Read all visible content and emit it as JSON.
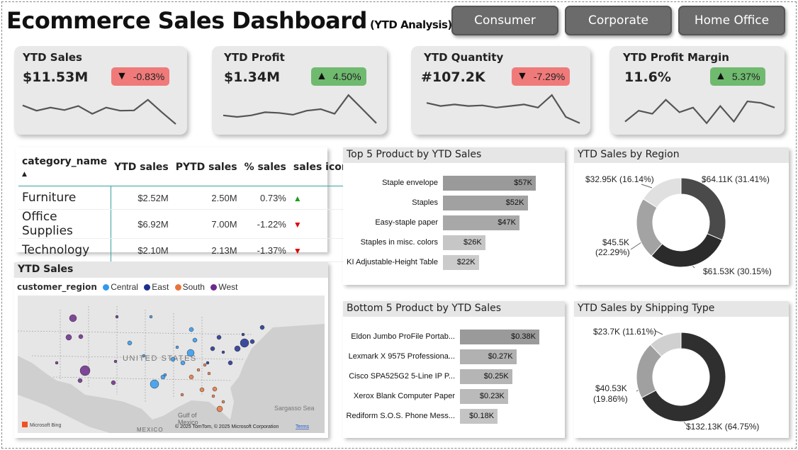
{
  "header": {
    "title": "Ecommerce Sales Dashboard",
    "subtitle": "(YTD Analysis)"
  },
  "segments": [
    "Consumer",
    "Corporate",
    "Home Office"
  ],
  "kpis": [
    {
      "title": "YTD Sales",
      "value": "$11.53M",
      "change": "-0.83%",
      "trend": "down",
      "spark": [
        0.62,
        0.45,
        0.55,
        0.47,
        0.6,
        0.35,
        0.55,
        0.45,
        0.46,
        0.8,
        0.4,
        0.02
      ]
    },
    {
      "title": "YTD Profit",
      "value": "$1.34M",
      "change": "4.50%",
      "trend": "up",
      "spark": [
        0.3,
        0.25,
        0.3,
        0.4,
        0.38,
        0.32,
        0.45,
        0.5,
        0.35,
        0.95,
        0.5,
        0.05
      ]
    },
    {
      "title": "YTD Quantity",
      "value": "#107.2K",
      "change": "-7.29%",
      "trend": "down",
      "spark": [
        0.7,
        0.6,
        0.65,
        0.6,
        0.62,
        0.55,
        0.6,
        0.65,
        0.55,
        0.95,
        0.25,
        0.05
      ]
    },
    {
      "title": "YTD Profit Margin",
      "value": "11.6%",
      "change": "5.37%",
      "trend": "up",
      "spark": [
        0.1,
        0.45,
        0.35,
        0.8,
        0.4,
        0.55,
        0.05,
        0.6,
        0.1,
        0.75,
        0.7,
        0.55
      ]
    }
  ],
  "category_table": {
    "headers": [
      "category_name",
      "YTD sales",
      "PYTD sales",
      "% sales",
      "sales icon"
    ],
    "rows": [
      {
        "name": "Furniture",
        "ytd": "$2.52M",
        "pytd": "2.50M",
        "pct": "0.73%",
        "icon": "▲",
        "dir": "up"
      },
      {
        "name": "Office Supplies",
        "ytd": "$6.92M",
        "pytd": "7.00M",
        "pct": "-1.22%",
        "icon": "▼",
        "dir": "down"
      },
      {
        "name": "Technology",
        "ytd": "$2.10M",
        "pytd": "2.13M",
        "pct": "-1.37%",
        "icon": "▼",
        "dir": "down"
      }
    ]
  },
  "map_panel": {
    "title": "YTD Sales",
    "legend_label": "customer_region",
    "regions": [
      {
        "name": "Central",
        "color": "#3399ee"
      },
      {
        "name": "East",
        "color": "#1f2f8f"
      },
      {
        "name": "South",
        "color": "#e8743b"
      },
      {
        "name": "West",
        "color": "#6b2a8a"
      }
    ],
    "country_label": "UNITED STATES",
    "gulf_label_1": "Gulf of",
    "gulf_label_2": "Mexico",
    "mexico_label": "MEXICO",
    "sea_label": "Sargasso Sea",
    "bing_label": "Microsoft Bing",
    "copyright": "© 2025 TomTom, © 2025 Microsoft Corporation",
    "terms": "Terms"
  },
  "top5": {
    "title": "Top 5 Product by YTD Sales",
    "items": [
      {
        "label": "Staple envelope",
        "value": 57,
        "text": "$57K"
      },
      {
        "label": "Staples",
        "value": 52,
        "text": "$52K"
      },
      {
        "label": "Easy-staple paper",
        "value": 47,
        "text": "$47K"
      },
      {
        "label": "Staples in misc. colors",
        "value": 26,
        "text": "$26K"
      },
      {
        "label": "KI Adjustable-Height Table",
        "value": 22,
        "text": "$22K"
      }
    ]
  },
  "bottom5": {
    "title": "Bottom 5 Product by YTD Sales",
    "items": [
      {
        "label": "Eldon Jumbo ProFile Portab...",
        "value": 0.38,
        "text": "$0.38K"
      },
      {
        "label": "Lexmark X 9575 Professiona...",
        "value": 0.27,
        "text": "$0.27K"
      },
      {
        "label": "Cisco SPA525G2 5-Line IP P...",
        "value": 0.25,
        "text": "$0.25K"
      },
      {
        "label": "Xerox Blank Computer Paper",
        "value": 0.23,
        "text": "$0.23K"
      },
      {
        "label": "Rediform S.O.S. Phone Mess...",
        "value": 0.18,
        "text": "$0.18K"
      }
    ]
  },
  "region_donut": {
    "title": "YTD Sales by Region",
    "labels": [
      "$64.11K (31.41%)",
      "$61.53K (30.15%)",
      "$45.5K",
      "(22.29%)",
      "$32.95K (16.14%)"
    ]
  },
  "shipping_donut": {
    "title": "YTD Sales by Shipping Type",
    "labels": [
      "$23.7K (11.61%)",
      "$40.53K",
      "(19.86%)",
      "$132.13K (64.75%)"
    ]
  },
  "chart_data": [
    {
      "type": "bar",
      "title": "Top 5 Product by YTD Sales",
      "categories": [
        "Staple envelope",
        "Staples",
        "Easy-staple paper",
        "Staples in misc. colors",
        "KI Adjustable-Height Table"
      ],
      "values": [
        57,
        52,
        47,
        26,
        22
      ],
      "unit": "$K"
    },
    {
      "type": "bar",
      "title": "Bottom 5 Product by YTD Sales",
      "categories": [
        "Eldon Jumbo ProFile Portab...",
        "Lexmark X 9575 Professiona...",
        "Cisco SPA525G2 5-Line IP P...",
        "Xerox Blank Computer Paper",
        "Rediform S.O.S. Phone Mess..."
      ],
      "values": [
        0.38,
        0.27,
        0.25,
        0.23,
        0.18
      ],
      "unit": "$K"
    },
    {
      "type": "pie",
      "title": "YTD Sales by Region",
      "values": [
        64.11,
        61.53,
        45.5,
        32.95
      ],
      "percent": [
        31.41,
        30.15,
        22.29,
        16.14
      ],
      "colors": [
        "#4a4a4a",
        "#2b2b2b",
        "#a3a3a3",
        "#e0e0e0"
      ]
    },
    {
      "type": "pie",
      "title": "YTD Sales by Shipping Type",
      "values": [
        132.13,
        40.53,
        23.7
      ],
      "percent": [
        64.75,
        19.86,
        11.61
      ],
      "colors": [
        "#2f2f2f",
        "#a0a0a0",
        "#d0d0d0"
      ]
    }
  ]
}
